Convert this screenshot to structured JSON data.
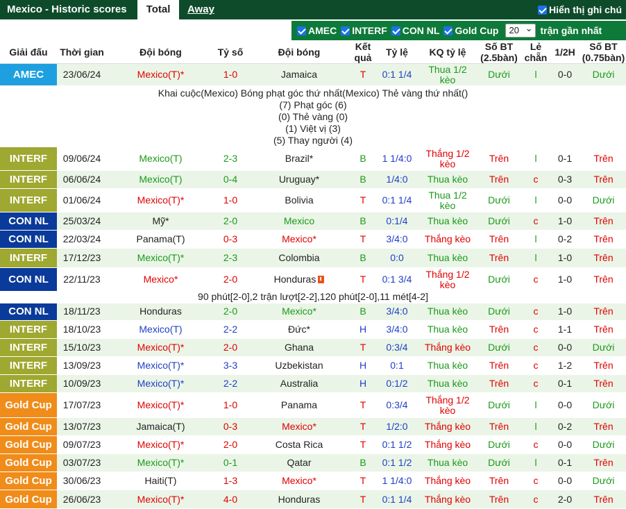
{
  "tabs": {
    "title": "Mexico - Historic scores",
    "total": "Total",
    "away": "Away",
    "show_note": "Hiển thị ghi chú"
  },
  "filters": {
    "items": [
      "AMEC",
      "INTERF",
      "CON NL",
      "Gold Cup"
    ],
    "count_value": "20",
    "count_label": "trận gần nhất"
  },
  "headers": {
    "league": "Giải đấu",
    "time": "Thời gian",
    "home": "Đội bóng",
    "score": "Tỷ số",
    "away": "Đội bóng",
    "result": "Kết quả",
    "odds": "Tỷ lệ",
    "odds_result": "KQ tỷ lệ",
    "goals": "Số BT (2.5bàn)",
    "oddeven": "Lẻ chẵn",
    "half": "1/2H",
    "goals_half": "Số BT (0.75bàn)"
  },
  "league_colors": {
    "AMEC": "#1ea0e0",
    "INTERF": "#9fa830",
    "CON NL": "#0a3a9a",
    "Gold Cup": "#f08c1a"
  },
  "matches": [
    {
      "league": "AMEC",
      "date": "23/06/24",
      "home": "Mexico(T)*",
      "home_c": "red",
      "score": "1-0",
      "score_c": "red",
      "away": "Jamaica",
      "away_c": "dark",
      "res": "T",
      "res_c": "red",
      "odds": "0:1 1/4",
      "odds_c": "blue",
      "kq": "Thua 1/2 kèo",
      "kq_c": "green",
      "bt": "Dưới",
      "bt_c": "green",
      "lc": "l",
      "lc_c": "green",
      "half": "0-0",
      "half_c": "dark",
      "bt2": "Dưới",
      "bt2_c": "green"
    },
    {
      "league": "INTERF",
      "date": "09/06/24",
      "home": "Mexico(T)",
      "home_c": "green",
      "score": "2-3",
      "score_c": "green",
      "away": "Brazil*",
      "away_c": "dark",
      "res": "B",
      "res_c": "green",
      "odds": "1 1/4:0",
      "odds_c": "blue",
      "kq": "Thắng 1/2 kèo",
      "kq_c": "red",
      "bt": "Trên",
      "bt_c": "red",
      "lc": "l",
      "lc_c": "green",
      "half": "0-1",
      "half_c": "dark",
      "bt2": "Trên",
      "bt2_c": "red"
    },
    {
      "league": "INTERF",
      "date": "06/06/24",
      "home": "Mexico(T)",
      "home_c": "green",
      "score": "0-4",
      "score_c": "green",
      "away": "Uruguay*",
      "away_c": "dark",
      "res": "B",
      "res_c": "green",
      "odds": "1/4:0",
      "odds_c": "blue",
      "kq": "Thua kèo",
      "kq_c": "green",
      "bt": "Trên",
      "bt_c": "red",
      "lc": "c",
      "lc_c": "red",
      "half": "0-3",
      "half_c": "dark",
      "bt2": "Trên",
      "bt2_c": "red"
    },
    {
      "league": "INTERF",
      "date": "01/06/24",
      "home": "Mexico(T)*",
      "home_c": "red",
      "score": "1-0",
      "score_c": "red",
      "away": "Bolivia",
      "away_c": "dark",
      "res": "T",
      "res_c": "red",
      "odds": "0:1 1/4",
      "odds_c": "blue",
      "kq": "Thua 1/2 kèo",
      "kq_c": "green",
      "bt": "Dưới",
      "bt_c": "green",
      "lc": "l",
      "lc_c": "green",
      "half": "0-0",
      "half_c": "dark",
      "bt2": "Dưới",
      "bt2_c": "green"
    },
    {
      "league": "CON NL",
      "date": "25/03/24",
      "home": "Mỹ*",
      "home_c": "dark",
      "score": "2-0",
      "score_c": "green",
      "away": "Mexico",
      "away_c": "green",
      "res": "B",
      "res_c": "green",
      "odds": "0:1/4",
      "odds_c": "blue",
      "kq": "Thua kèo",
      "kq_c": "green",
      "bt": "Dưới",
      "bt_c": "green",
      "lc": "c",
      "lc_c": "red",
      "half": "1-0",
      "half_c": "dark",
      "bt2": "Trên",
      "bt2_c": "red"
    },
    {
      "league": "CON NL",
      "date": "22/03/24",
      "home": "Panama(T)",
      "home_c": "dark",
      "score": "0-3",
      "score_c": "red",
      "away": "Mexico*",
      "away_c": "red",
      "res": "T",
      "res_c": "red",
      "odds": "3/4:0",
      "odds_c": "blue",
      "kq": "Thắng kèo",
      "kq_c": "red",
      "bt": "Trên",
      "bt_c": "red",
      "lc": "l",
      "lc_c": "green",
      "half": "0-2",
      "half_c": "dark",
      "bt2": "Trên",
      "bt2_c": "red"
    },
    {
      "league": "INTERF",
      "date": "17/12/23",
      "home": "Mexico(T)*",
      "home_c": "green",
      "score": "2-3",
      "score_c": "green",
      "away": "Colombia",
      "away_c": "dark",
      "res": "B",
      "res_c": "green",
      "odds": "0:0",
      "odds_c": "blue",
      "kq": "Thua kèo",
      "kq_c": "green",
      "bt": "Trên",
      "bt_c": "red",
      "lc": "l",
      "lc_c": "green",
      "half": "1-0",
      "half_c": "dark",
      "bt2": "Trên",
      "bt2_c": "red"
    },
    {
      "league": "CON NL",
      "date": "22/11/23",
      "home": "Mexico*",
      "home_c": "red",
      "score": "2-0",
      "score_c": "red",
      "away": "Honduras",
      "away_c": "dark",
      "card": true,
      "res": "T",
      "res_c": "red",
      "odds": "0:1 3/4",
      "odds_c": "blue",
      "kq": "Thắng 1/2 kèo",
      "kq_c": "red",
      "bt": "Dưới",
      "bt_c": "green",
      "lc": "c",
      "lc_c": "red",
      "half": "1-0",
      "half_c": "dark",
      "bt2": "Trên",
      "bt2_c": "red"
    },
    {
      "league": "CON NL",
      "date": "18/11/23",
      "home": "Honduras",
      "home_c": "dark",
      "score": "2-0",
      "score_c": "green",
      "away": "Mexico*",
      "away_c": "green",
      "res": "B",
      "res_c": "green",
      "odds": "3/4:0",
      "odds_c": "blue",
      "kq": "Thua kèo",
      "kq_c": "green",
      "bt": "Dưới",
      "bt_c": "green",
      "lc": "c",
      "lc_c": "red",
      "half": "1-0",
      "half_c": "dark",
      "bt2": "Trên",
      "bt2_c": "red"
    },
    {
      "league": "INTERF",
      "date": "18/10/23",
      "home": "Mexico(T)",
      "home_c": "blue",
      "score": "2-2",
      "score_c": "blue",
      "away": "Đức*",
      "away_c": "dark",
      "res": "H",
      "res_c": "blue",
      "odds": "3/4:0",
      "odds_c": "blue",
      "kq": "Thua kèo",
      "kq_c": "green",
      "bt": "Trên",
      "bt_c": "red",
      "lc": "c",
      "lc_c": "red",
      "half": "1-1",
      "half_c": "dark",
      "bt2": "Trên",
      "bt2_c": "red"
    },
    {
      "league": "INTERF",
      "date": "15/10/23",
      "home": "Mexico(T)*",
      "home_c": "red",
      "score": "2-0",
      "score_c": "red",
      "away": "Ghana",
      "away_c": "dark",
      "res": "T",
      "res_c": "red",
      "odds": "0:3/4",
      "odds_c": "blue",
      "kq": "Thắng kèo",
      "kq_c": "red",
      "bt": "Dưới",
      "bt_c": "green",
      "lc": "c",
      "lc_c": "red",
      "half": "0-0",
      "half_c": "dark",
      "bt2": "Dưới",
      "bt2_c": "green"
    },
    {
      "league": "INTERF",
      "date": "13/09/23",
      "home": "Mexico(T)*",
      "home_c": "blue",
      "score": "3-3",
      "score_c": "blue",
      "away": "Uzbekistan",
      "away_c": "dark",
      "res": "H",
      "res_c": "blue",
      "odds": "0:1",
      "odds_c": "blue",
      "kq": "Thua kèo",
      "kq_c": "green",
      "bt": "Trên",
      "bt_c": "red",
      "lc": "c",
      "lc_c": "red",
      "half": "1-2",
      "half_c": "dark",
      "bt2": "Trên",
      "bt2_c": "red"
    },
    {
      "league": "INTERF",
      "date": "10/09/23",
      "home": "Mexico(T)*",
      "home_c": "blue",
      "score": "2-2",
      "score_c": "blue",
      "away": "Australia",
      "away_c": "dark",
      "res": "H",
      "res_c": "blue",
      "odds": "0:1/2",
      "odds_c": "blue",
      "kq": "Thua kèo",
      "kq_c": "green",
      "bt": "Trên",
      "bt_c": "red",
      "lc": "c",
      "lc_c": "red",
      "half": "0-1",
      "half_c": "dark",
      "bt2": "Trên",
      "bt2_c": "red"
    },
    {
      "league": "Gold Cup",
      "date": "17/07/23",
      "home": "Mexico(T)*",
      "home_c": "red",
      "score": "1-0",
      "score_c": "red",
      "away": "Panama",
      "away_c": "dark",
      "res": "T",
      "res_c": "red",
      "odds": "0:3/4",
      "odds_c": "blue",
      "kq": "Thắng 1/2 kèo",
      "kq_c": "red",
      "bt": "Dưới",
      "bt_c": "green",
      "lc": "l",
      "lc_c": "green",
      "half": "0-0",
      "half_c": "dark",
      "bt2": "Dưới",
      "bt2_c": "green"
    },
    {
      "league": "Gold Cup",
      "date": "13/07/23",
      "home": "Jamaica(T)",
      "home_c": "dark",
      "score": "0-3",
      "score_c": "red",
      "away": "Mexico*",
      "away_c": "red",
      "res": "T",
      "res_c": "red",
      "odds": "1/2:0",
      "odds_c": "blue",
      "kq": "Thắng kèo",
      "kq_c": "red",
      "bt": "Trên",
      "bt_c": "red",
      "lc": "l",
      "lc_c": "green",
      "half": "0-2",
      "half_c": "dark",
      "bt2": "Trên",
      "bt2_c": "red"
    },
    {
      "league": "Gold Cup",
      "date": "09/07/23",
      "home": "Mexico(T)*",
      "home_c": "red",
      "score": "2-0",
      "score_c": "red",
      "away": "Costa Rica",
      "away_c": "dark",
      "res": "T",
      "res_c": "red",
      "odds": "0:1 1/2",
      "odds_c": "blue",
      "kq": "Thắng kèo",
      "kq_c": "red",
      "bt": "Dưới",
      "bt_c": "green",
      "lc": "c",
      "lc_c": "red",
      "half": "0-0",
      "half_c": "dark",
      "bt2": "Dưới",
      "bt2_c": "green"
    },
    {
      "league": "Gold Cup",
      "date": "03/07/23",
      "home": "Mexico(T)*",
      "home_c": "green",
      "score": "0-1",
      "score_c": "green",
      "away": "Qatar",
      "away_c": "dark",
      "res": "B",
      "res_c": "green",
      "odds": "0:1 1/2",
      "odds_c": "blue",
      "kq": "Thua kèo",
      "kq_c": "green",
      "bt": "Dưới",
      "bt_c": "green",
      "lc": "l",
      "lc_c": "green",
      "half": "0-1",
      "half_c": "dark",
      "bt2": "Trên",
      "bt2_c": "red"
    },
    {
      "league": "Gold Cup",
      "date": "30/06/23",
      "home": "Haiti(T)",
      "home_c": "dark",
      "score": "1-3",
      "score_c": "red",
      "away": "Mexico*",
      "away_c": "red",
      "res": "T",
      "res_c": "red",
      "odds": "1 1/4:0",
      "odds_c": "blue",
      "kq": "Thắng kèo",
      "kq_c": "red",
      "bt": "Trên",
      "bt_c": "red",
      "lc": "c",
      "lc_c": "red",
      "half": "0-0",
      "half_c": "dark",
      "bt2": "Dưới",
      "bt2_c": "green"
    },
    {
      "league": "Gold Cup",
      "date": "26/06/23",
      "home": "Mexico(T)*",
      "home_c": "red",
      "score": "4-0",
      "score_c": "red",
      "away": "Honduras",
      "away_c": "dark",
      "res": "T",
      "res_c": "red",
      "odds": "0:1 1/4",
      "odds_c": "blue",
      "kq": "Thắng kèo",
      "kq_c": "red",
      "bt": "Trên",
      "bt_c": "red",
      "lc": "c",
      "lc_c": "red",
      "half": "2-0",
      "half_c": "dark",
      "bt2": "Trên",
      "bt2_c": "red"
    }
  ],
  "detail_first": [
    "Khai cuộc(Mexico)  Bóng phạt góc thứ nhất(Mexico)  Thẻ vàng thứ nhất()",
    "(7) Phạt góc (6)",
    "(0) Thẻ vàng (0)",
    "(1) Việt vị (3)",
    "(5) Thay người (4)"
  ],
  "detail_second": "90 phút[2-0],2 trận lượt[2-2],120 phút[2-0],11 mét[4-2]"
}
